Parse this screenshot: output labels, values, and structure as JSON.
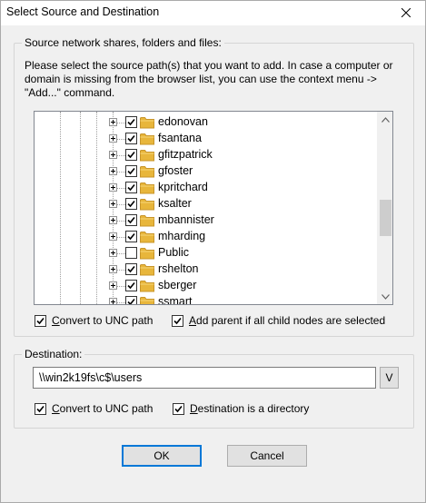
{
  "window": {
    "title": "Select Source and Destination"
  },
  "source": {
    "group_title": "Source network shares, folders and files:",
    "description": "Please select the source path(s) that you want to add. In case a computer or domain is missing from the browser list, you can use the context menu -> \"Add...\" command.",
    "tree_items": [
      {
        "label": "edonovan",
        "checked": true
      },
      {
        "label": "fsantana",
        "checked": true
      },
      {
        "label": "gfitzpatrick",
        "checked": true
      },
      {
        "label": "gfoster",
        "checked": true
      },
      {
        "label": "kpritchard",
        "checked": true
      },
      {
        "label": "ksalter",
        "checked": true
      },
      {
        "label": "mbannister",
        "checked": true
      },
      {
        "label": "mharding",
        "checked": true
      },
      {
        "label": "Public",
        "checked": false
      },
      {
        "label": "rshelton",
        "checked": true
      },
      {
        "label": "sberger",
        "checked": true
      },
      {
        "label": "ssmart",
        "checked": true
      }
    ],
    "convert_unc": {
      "prefix": "C",
      "rest": "onvert to UNC path",
      "checked": true
    },
    "add_parent": {
      "prefix": "A",
      "rest": "dd parent if all child nodes are selected",
      "checked": true
    }
  },
  "destination": {
    "group_title": "Destination:",
    "path": "\\\\win2k19fs\\c$\\users",
    "browse_label": "V",
    "convert_unc": {
      "prefix": "C",
      "rest": "onvert to UNC path",
      "checked": true
    },
    "is_directory": {
      "prefix": "D",
      "rest": "estination is a directory",
      "checked": true
    }
  },
  "buttons": {
    "ok": "OK",
    "cancel": "Cancel"
  },
  "icons": {
    "close": "close-icon",
    "folder": "folder-icon",
    "check": "check-icon",
    "expander": "plus-box-icon"
  },
  "colors": {
    "folder": "#e8b63b",
    "focus_border": "#0078d7"
  }
}
